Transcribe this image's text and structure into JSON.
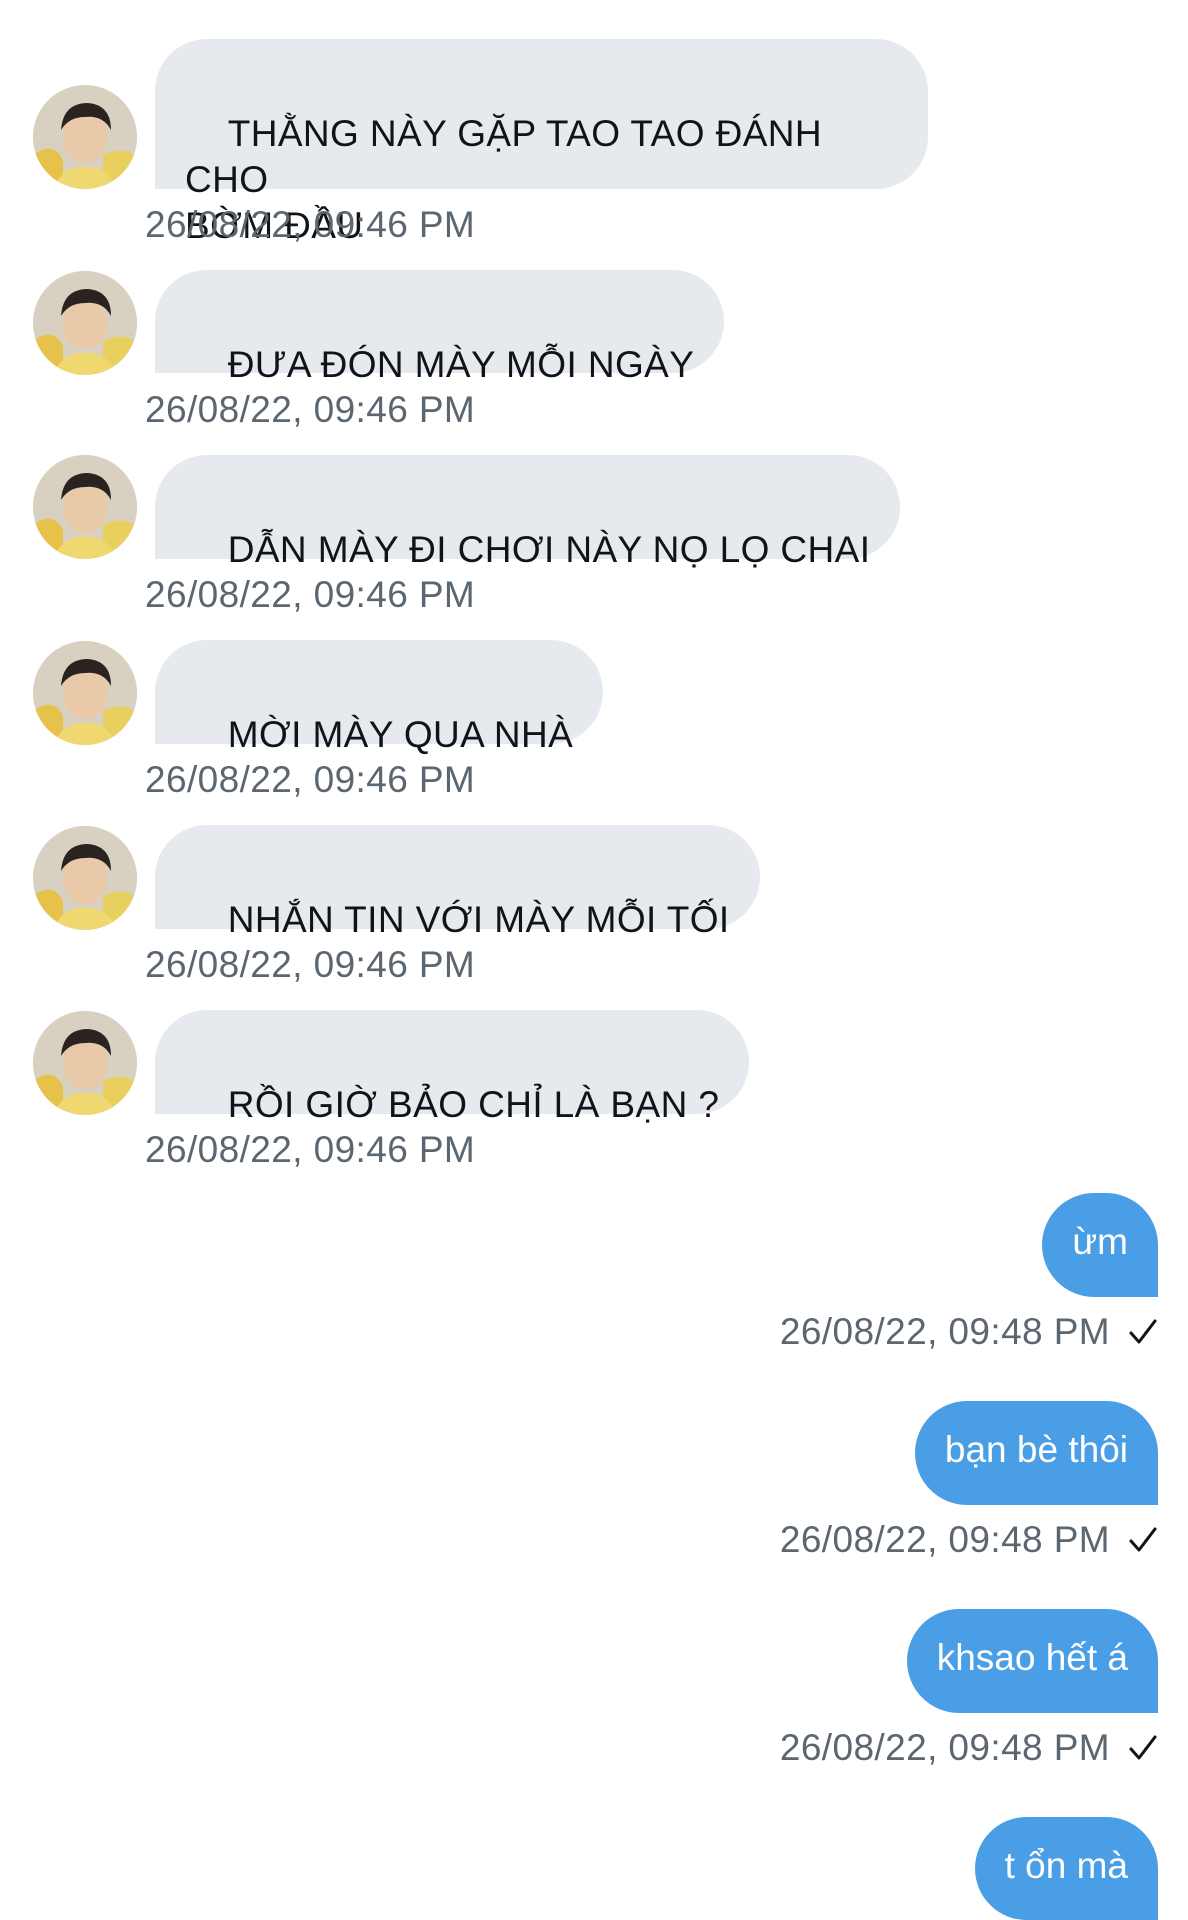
{
  "conversation": {
    "incoming": [
      {
        "text": "THẰNG NÀY GẶP TAO TAO ĐÁNH CHO\nBỜM ĐẦU",
        "time": "26/08/22, 09:46 PM"
      },
      {
        "text": "ĐƯA ĐÓN MÀY MỖI NGÀY",
        "time": "26/08/22, 09:46 PM"
      },
      {
        "text": "DẪN MÀY ĐI CHƠI NÀY NỌ LỌ CHAI",
        "time": "26/08/22, 09:46 PM"
      },
      {
        "text": "MỜI MÀY QUA NHÀ",
        "time": "26/08/22, 09:46 PM"
      },
      {
        "text": "NHẮN TIN VỚI MÀY MỖI TỐI",
        "time": "26/08/22, 09:46 PM"
      },
      {
        "text": "RỒI GIỜ BẢO CHỈ LÀ BẠN ?",
        "time": "26/08/22, 09:46 PM"
      }
    ],
    "outgoing": [
      {
        "text": "ừm",
        "time": "26/08/22, 09:48 PM"
      },
      {
        "text": "bạn bè thôi",
        "time": "26/08/22, 09:48 PM"
      },
      {
        "text": "khsao hết á",
        "time": "26/08/22, 09:48 PM"
      },
      {
        "text": "t ổn mà"
      }
    ]
  },
  "colors": {
    "incoming_bubble": "#e6e9ee",
    "outgoing_bubble": "#4a9ee5",
    "timestamp": "#5b6670"
  },
  "icons": {
    "read_receipt": "check-icon",
    "avatar": "avatar"
  }
}
